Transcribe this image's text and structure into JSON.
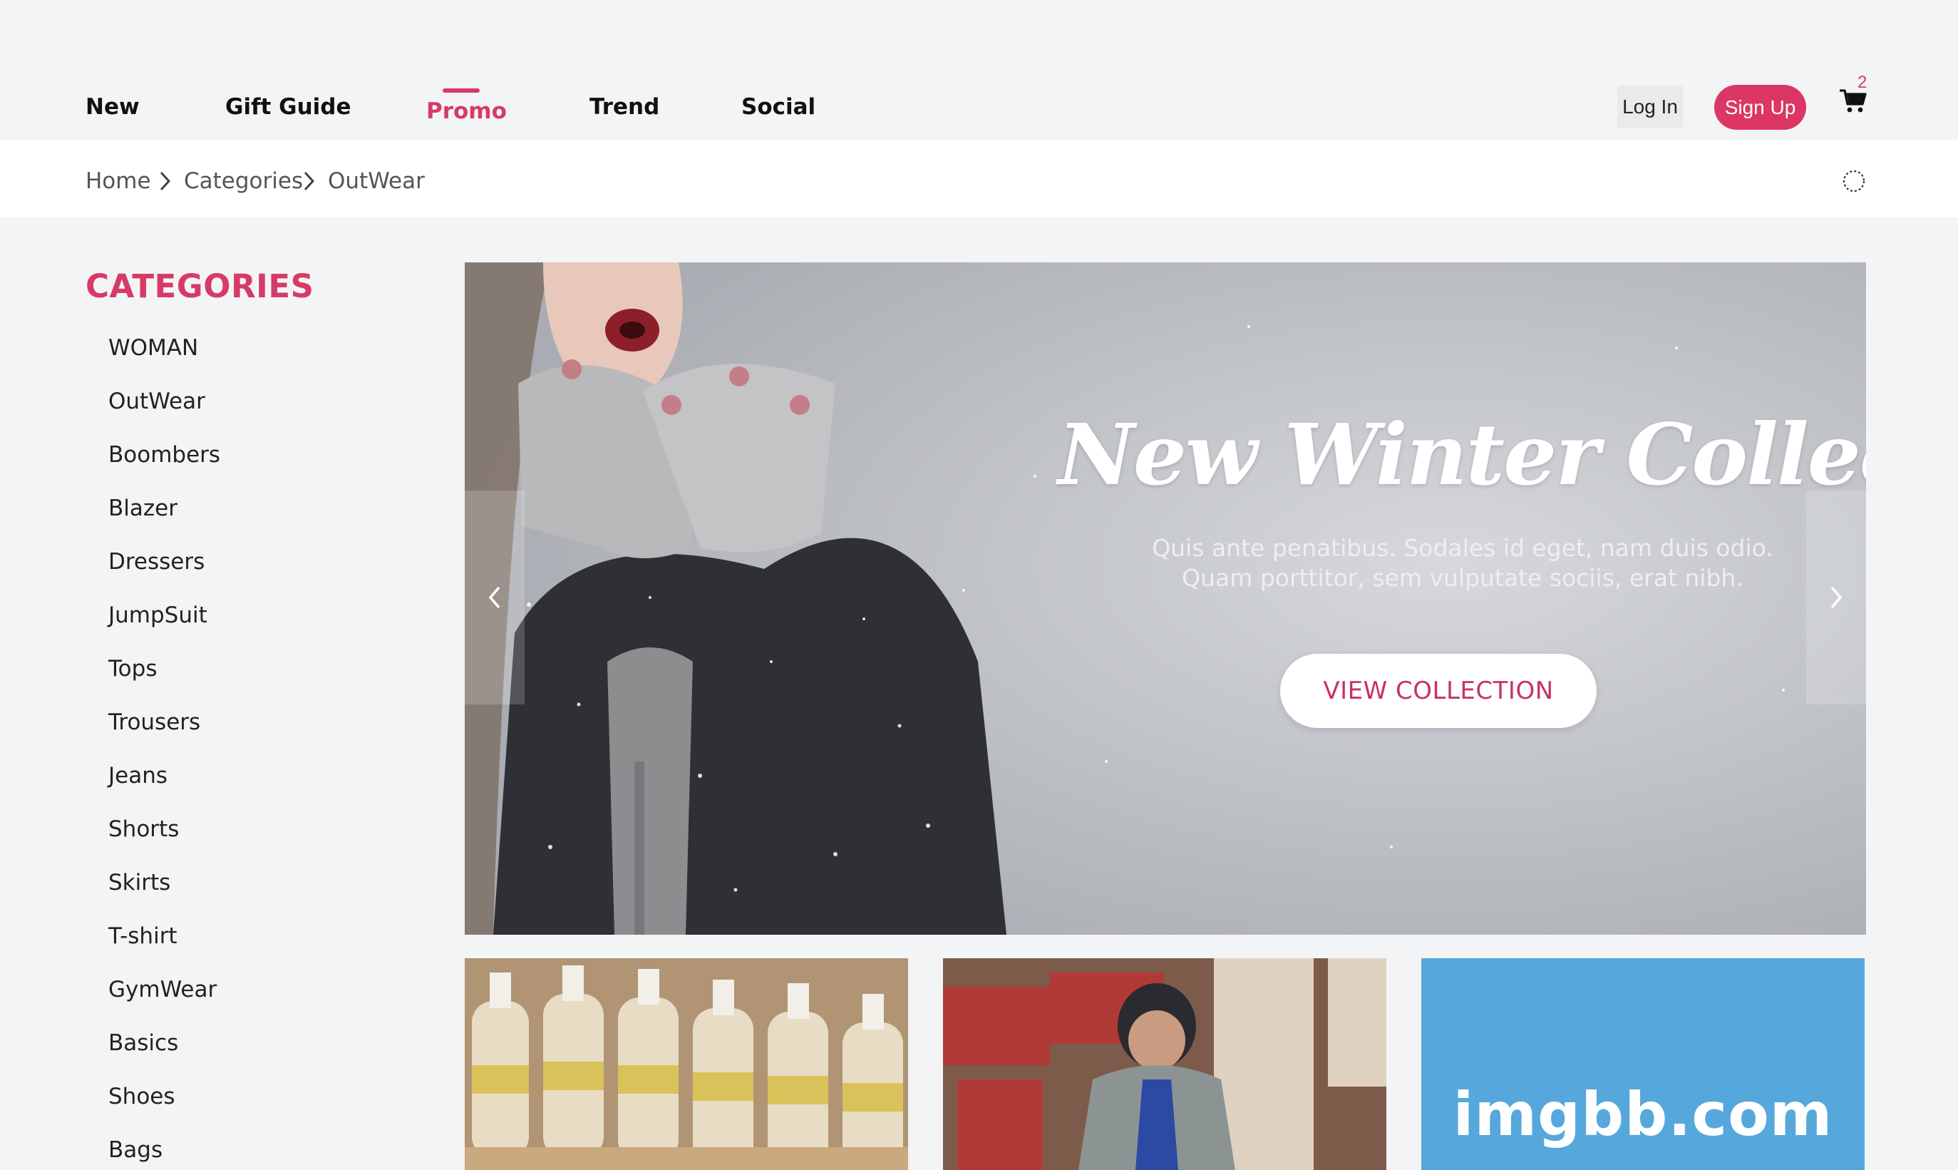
{
  "nav": {
    "items": [
      "New",
      "Gift Guide",
      "Promo",
      "Trend",
      "Social"
    ],
    "active": "Promo",
    "login_label": "Log In",
    "signup_label": "Sign Up",
    "cart_count": "2"
  },
  "breadcrumb": {
    "items": [
      "Home",
      "Categories",
      "OutWear"
    ]
  },
  "sidebar": {
    "title": "CATEGORIES",
    "items": [
      "WOMAN",
      "OutWear",
      "Boombers",
      "Blazer",
      "Dressers",
      "JumpSuit",
      "Tops",
      "Trousers",
      "Jeans",
      "Shorts",
      "Skirts",
      "T-shirt",
      "GymWear",
      "Basics",
      "Shoes",
      "Bags"
    ]
  },
  "hero": {
    "title": "New Winter Collection",
    "subtitle_line1": "Quis ante penatibus. Sodales id eget, nam duis odio.",
    "subtitle_line2": "Quam porttitor, sem vulputate sociis, erat nibh.",
    "cta_label": "VIEW COLLECTION"
  },
  "tiles": {
    "third_label": "imgbb.com"
  },
  "colors": {
    "accent": "#dc3664",
    "page_bg": "#f3f4f6",
    "imgbb_blue": "#56a8dc"
  }
}
